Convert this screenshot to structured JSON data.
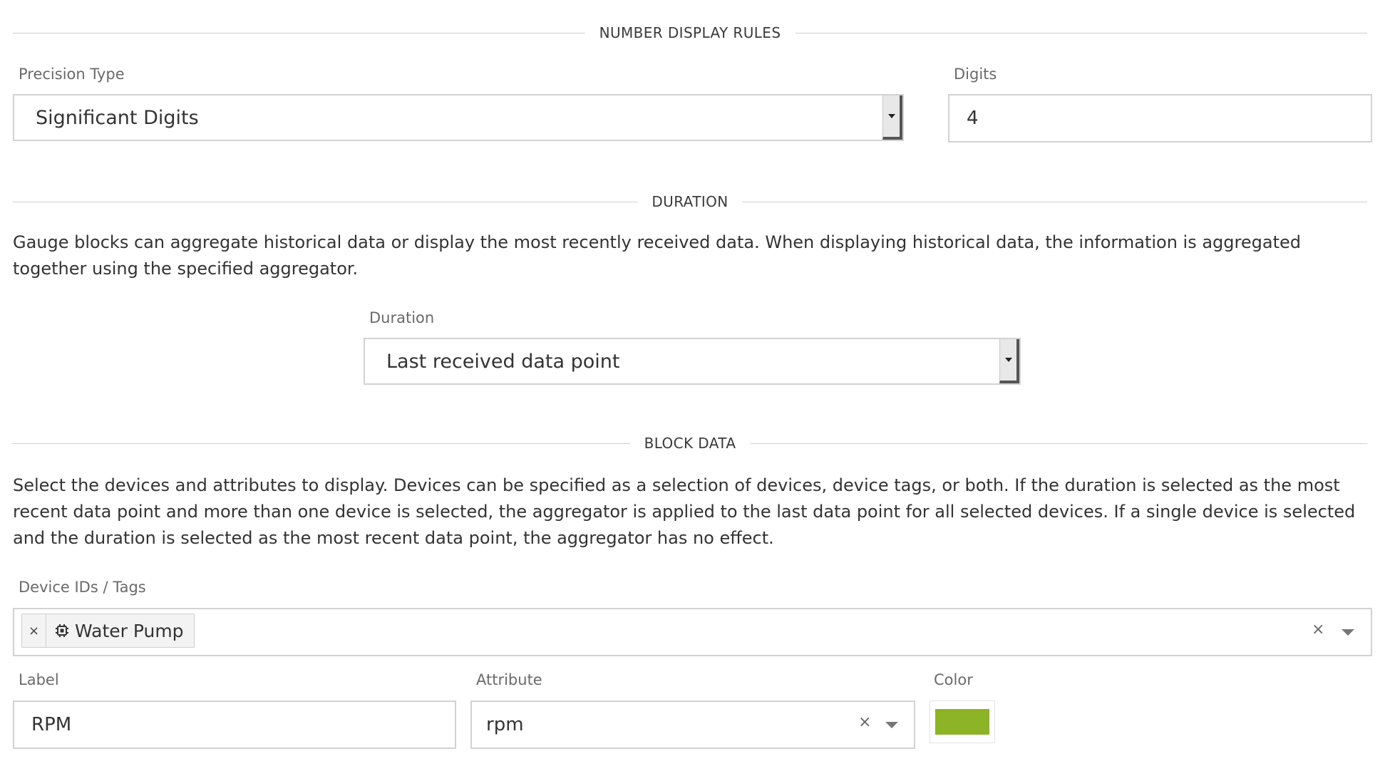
{
  "sections": {
    "number_display_rules": "NUMBER DISPLAY RULES",
    "duration": "DURATION",
    "block_data": "BLOCK DATA"
  },
  "precision": {
    "label": "Precision Type",
    "value": "Significant Digits"
  },
  "digits": {
    "label": "Digits",
    "value": "4"
  },
  "duration": {
    "description": "Gauge blocks can aggregate historical data or display the most recently received data. When displaying historical data, the information is aggregated together using the specified aggregator.",
    "label": "Duration",
    "value": "Last received data point"
  },
  "block_data": {
    "description": "Select the devices and attributes to display. Devices can be specified as a selection of devices, device tags, or both. If the duration is selected as the most recent data point and more than one device is selected, the aggregator is applied to the last data point for all selected devices. If a single device is selected and the duration is selected as the most recent data point, the aggregator has no effect.",
    "devices_label": "Device IDs / Tags",
    "devices": [
      {
        "label": "Water Pump",
        "remove": "×",
        "icon": "chip-icon"
      }
    ],
    "clear": "×"
  },
  "series": {
    "label_label": "Label",
    "label_value": "RPM",
    "attribute_label": "Attribute",
    "attribute_value": "rpm",
    "attribute_clear": "×",
    "color_label": "Color",
    "color_value": "#8db326"
  }
}
